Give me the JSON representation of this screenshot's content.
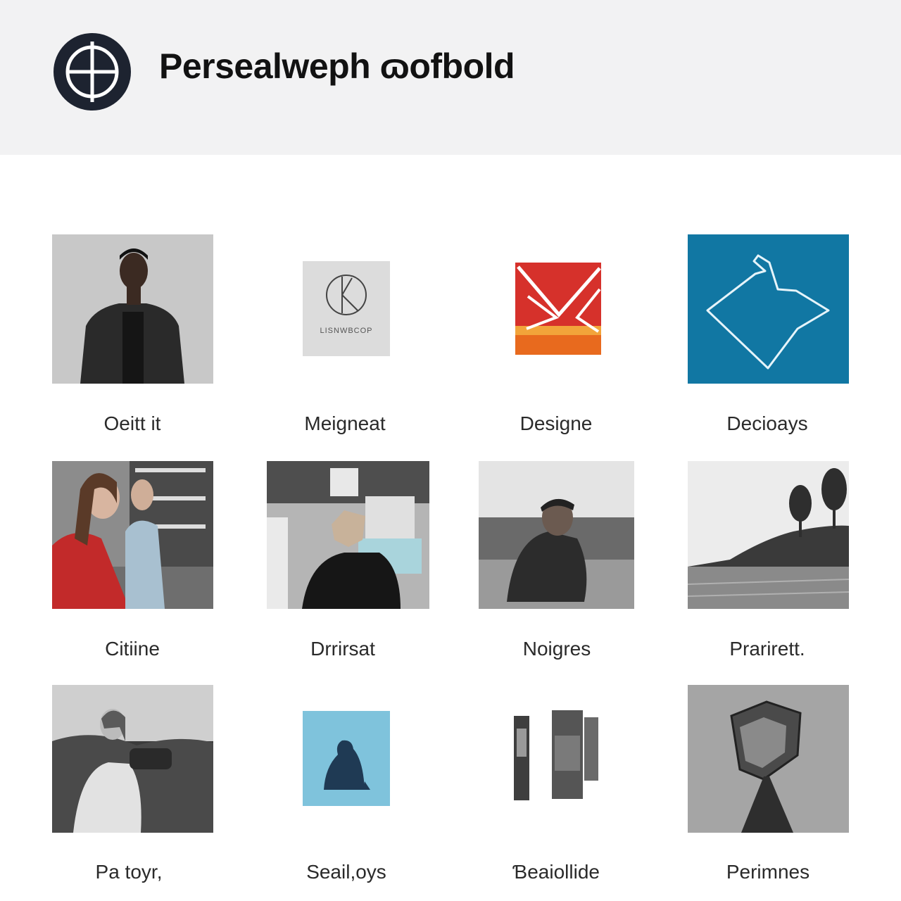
{
  "site": {
    "title": "Persealweph ɷofbold"
  },
  "gallery": {
    "items": [
      {
        "caption": "Oeitt it"
      },
      {
        "caption": "Meignea​t"
      },
      {
        "caption": "Designe"
      },
      {
        "caption": "Decioays"
      },
      {
        "caption": "Citiine"
      },
      {
        "caption": "Drrirsat"
      },
      {
        "caption": "Noigres"
      },
      {
        "caption": "Prarirett."
      },
      {
        "caption": "Pa toyr,"
      },
      {
        "caption": "Seail,oys"
      },
      {
        "caption": "Ɓeaiollide"
      },
      {
        "caption": "Perimnes"
      }
    ],
    "thumbnail_labels": {
      "logo_card": "LISNWBCOP"
    }
  },
  "colors": {
    "header_bg": "#f2f2f3",
    "logo_dark": "#1d2330",
    "blue_tile": "#1177a3",
    "light_blue_tile": "#7fc3dc",
    "red_tile": "#d6312b"
  }
}
